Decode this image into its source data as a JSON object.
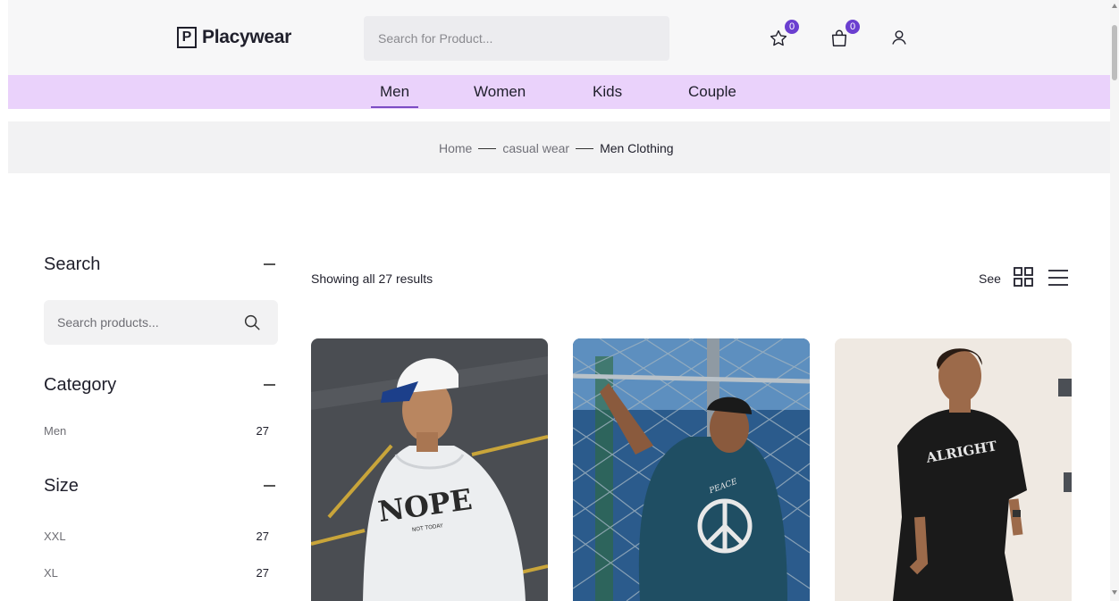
{
  "header": {
    "logo_letter": "P",
    "logo_text": "Placywear",
    "search_placeholder": "Search for Product...",
    "wishlist_count": "0",
    "cart_count": "0",
    "icons": [
      "star-icon",
      "shopping-bag-icon",
      "user-icon"
    ]
  },
  "nav": {
    "items": [
      {
        "label": "Men",
        "active": true
      },
      {
        "label": "Women",
        "active": false
      },
      {
        "label": "Kids",
        "active": false
      },
      {
        "label": "Couple",
        "active": false
      }
    ]
  },
  "breadcrumb": {
    "items": [
      "Home",
      "casual wear",
      "Men Clothing"
    ]
  },
  "sidebar": {
    "search_title": "Search",
    "search_placeholder": "Search products...",
    "category_title": "Category",
    "categories": [
      {
        "label": "Men",
        "count": "27"
      }
    ],
    "size_title": "Size",
    "sizes": [
      {
        "label": "XXL",
        "count": "27"
      },
      {
        "label": "XL",
        "count": "27"
      }
    ]
  },
  "main": {
    "results_text": "Showing all 27 results",
    "see_label": "See",
    "products": [
      {
        "graphic_text": "NOPE",
        "graphic_subtext": "NOT TODAY",
        "garment": "white hoodie"
      },
      {
        "graphic_text": "PEACE",
        "garment": "teal t-shirt"
      },
      {
        "graphic_text": "ALRIGHT",
        "garment": "black t-shirt"
      }
    ]
  },
  "colors": {
    "accent": "#6b3fd0",
    "nav_bg": "#ead2fb",
    "nav_underline": "#7c4cc4",
    "header_bg": "#f7f7f8",
    "breadcrumb_bg": "#f2f2f3"
  }
}
